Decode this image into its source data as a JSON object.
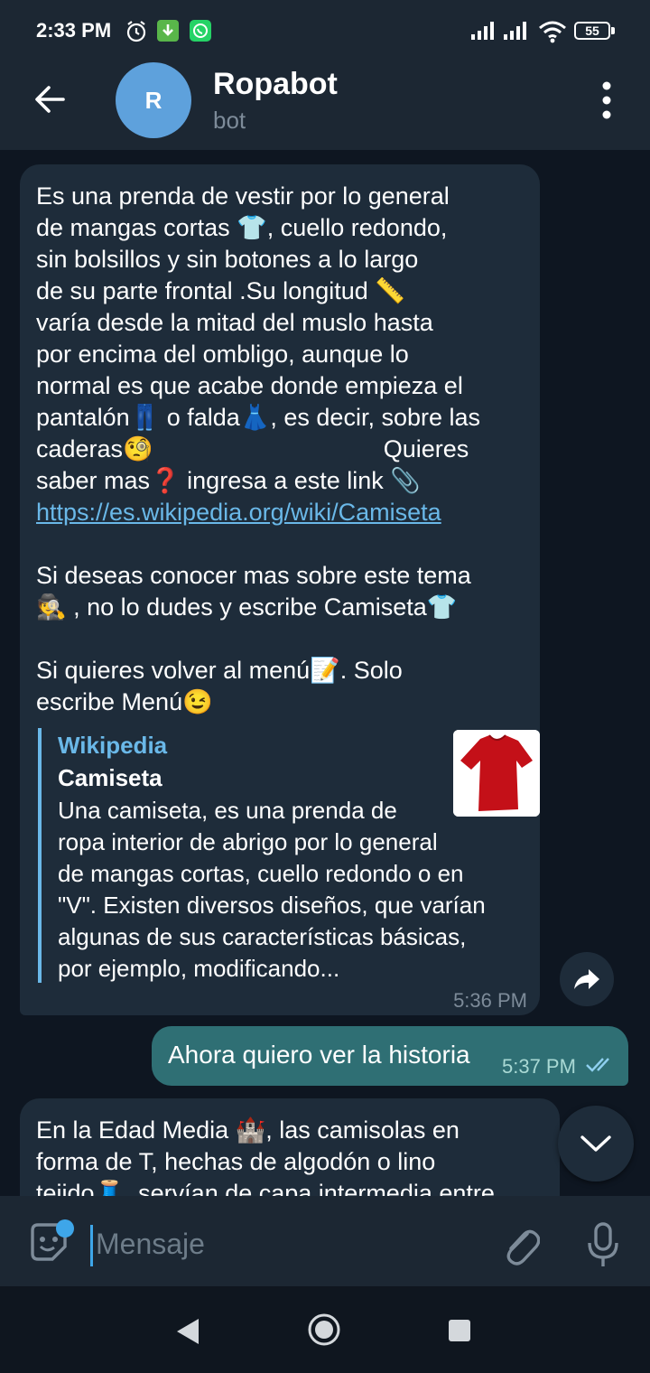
{
  "status_bar": {
    "time": "2:33 PM",
    "battery": "55"
  },
  "header": {
    "avatar_letter": "R",
    "title": "Ropabot",
    "subtitle": "bot"
  },
  "messages": {
    "msg1": {
      "text": "Es una prenda de vestir por lo general\nde mangas cortas 👕, cuello redondo,\nsin bolsillos y sin botones a lo largo\nde su parte frontal .Su longitud 📏\nvaría desde la mitad del muslo hasta\npor encima del ombligo, aunque lo\nnormal es que acabe donde empieza el\npantalón👖 o falda👗, es decir, sobre las\ncaderas🧐                                  Quieres\nsaber mas❓ ingresa a este link 📎",
      "link": "https://es.wikipedia.org/wiki/Camiseta",
      "text2": "Si deseas conocer mas sobre este tema\n🕵️ , no lo dudes y escribe Camiseta👕\n\nSi quieres volver al menú📝. Solo\nescribe Menú😉",
      "preview": {
        "site": "Wikipedia",
        "title": "Camiseta",
        "description": "Una camiseta, es una prenda de\nropa interior de abrigo por lo general\nde mangas cortas, cuello redondo o en\n\"V\". Existen diversos diseños, que varían\nalgunas de sus características básicas,\npor ejemplo, modificando..."
      },
      "time": "5:36 PM"
    },
    "msg2": {
      "text": "Ahora quiero ver la historia",
      "time": "5:37 PM"
    },
    "msg3": {
      "text": "En la Edad Media 🏰, las camisolas en\nforma de T, hechas de algodón o lino\ntejido🧵, servían de capa intermedia entre"
    }
  },
  "input": {
    "placeholder": "Mensaje"
  },
  "colors": {
    "background": "#0e1621",
    "incoming": "#1e2c3a",
    "outgoing": "#2f6f74",
    "accent": "#6ab8e8"
  }
}
